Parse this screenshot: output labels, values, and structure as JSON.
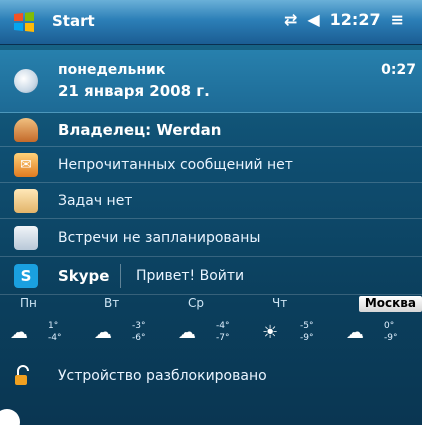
{
  "taskbar": {
    "title": "Start",
    "clock": "12:27"
  },
  "today": {
    "date": {
      "weekday": "понедельник",
      "full_date": "21 января 2008 г.",
      "time_right": "0:27"
    },
    "owner": {
      "label": "Владелец: Werdan"
    },
    "messages": {
      "label": "Непрочитанных сообщений нет"
    },
    "tasks": {
      "label": "Задач нет"
    },
    "appointments": {
      "label": "Встречи не запланированы"
    },
    "skype": {
      "name": "Skype",
      "action": "Привет! Войти"
    },
    "weather": {
      "city": "Москва",
      "days": [
        {
          "name": "Пн",
          "icon": "partly-cloudy-icon",
          "high": "1°",
          "low": "-4°"
        },
        {
          "name": "Вт",
          "icon": "snow-cloud-icon",
          "high": "-3°",
          "low": "-6°"
        },
        {
          "name": "Ср",
          "icon": "partly-cloudy-icon",
          "high": "-4°",
          "low": "-7°"
        },
        {
          "name": "Чт",
          "icon": "sun-cloud-icon",
          "high": "-5°",
          "low": "-9°"
        },
        {
          "name": "",
          "icon": "snow-cloud-icon",
          "high": "0°",
          "low": "-9°"
        }
      ]
    },
    "lock": {
      "label": "Устройство разблокировано"
    }
  }
}
